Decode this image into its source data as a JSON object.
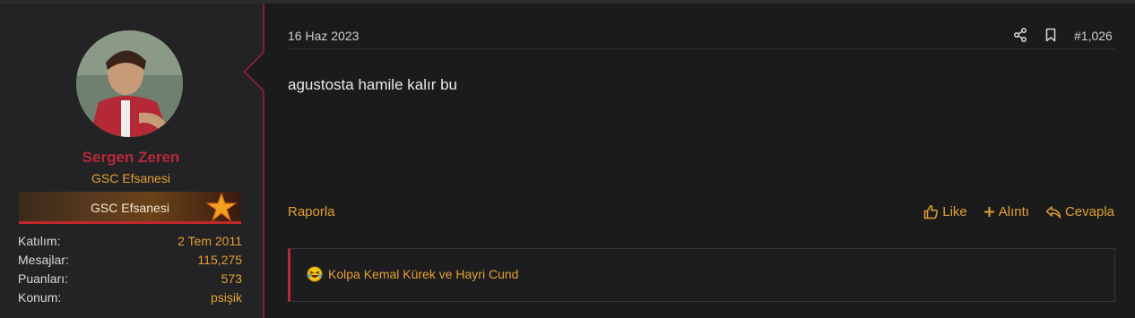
{
  "user": {
    "name": "Sergen Zeren",
    "title": "GSC Efsanesi",
    "banner": "GSC Efsanesi",
    "stats": [
      {
        "label": "Katılım:",
        "value": "2 Tem 2011"
      },
      {
        "label": "Mesajlar:",
        "value": "115,275"
      },
      {
        "label": "Puanları:",
        "value": "573"
      },
      {
        "label": "Konum:",
        "value": "psişik"
      }
    ]
  },
  "post": {
    "date": "16 Haz 2023",
    "number": "#1,026",
    "body": "agustosta hamile kalır bu",
    "report": "Raporla",
    "actions": {
      "like": "Like",
      "quote": "Alıntı",
      "reply": "Cevapla"
    },
    "reactions_text": "Kolpa Kemal Kürek ve Hayri Cund"
  },
  "colors": {
    "accent": "#e3a032",
    "username": "#b8283c",
    "border": "#7a2230"
  }
}
